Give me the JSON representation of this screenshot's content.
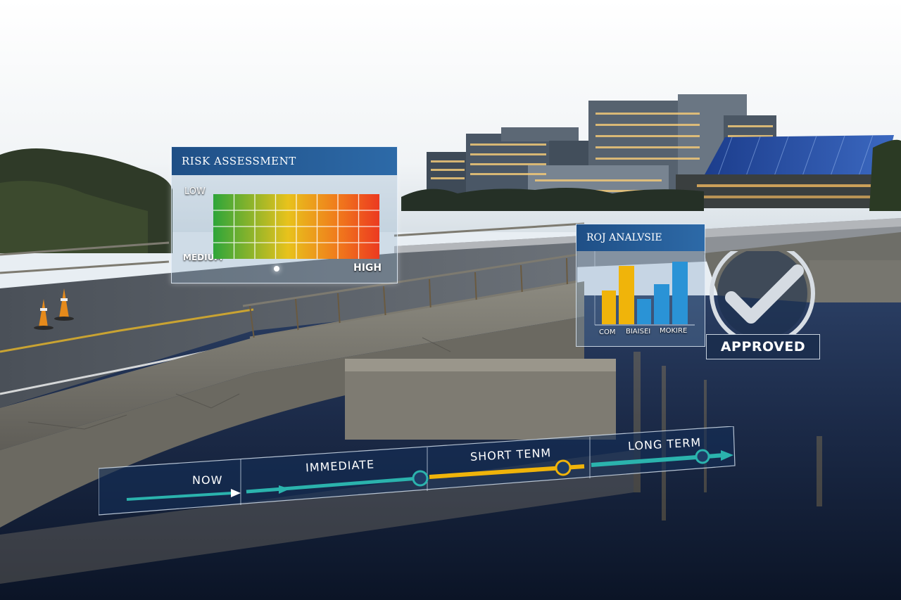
{
  "risk_panel": {
    "title": "RISK ASSESSMENT",
    "label_low": "LOW",
    "label_medium": "MEDIUM",
    "label_high": "HIGH"
  },
  "roi_panel": {
    "title": "ROJ ANALVSIE",
    "axis_labels": [
      "COM",
      "BIAISEI",
      "MOKIRE"
    ]
  },
  "approved_badge": {
    "label": "APPROVED"
  },
  "timeline": {
    "stages": [
      "NOW",
      "IMMEDIATE",
      "SHORT TENM",
      "LONG TERM"
    ]
  },
  "colors": {
    "panel_header": "#2d6aa8",
    "risk_low": "#2ea53a",
    "risk_mid": "#e8c21c",
    "risk_high": "#ec3a20",
    "roi_gold": "#f0b40a",
    "roi_blue": "#2a93d6",
    "timeline_teal": "#2bb3ad",
    "timeline_gold": "#f0b40a"
  }
}
